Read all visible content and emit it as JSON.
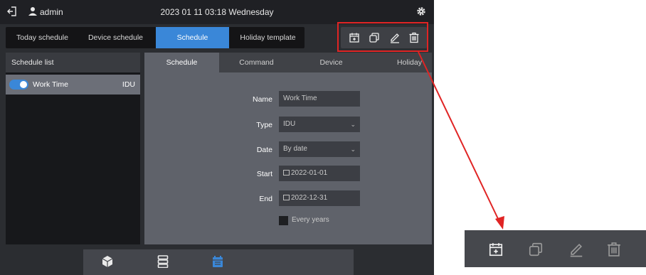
{
  "header": {
    "user": "admin",
    "datetime": "2023 01 11 03:18 Wednesday"
  },
  "nav": {
    "tabs": [
      "Today schedule",
      "Device schedule",
      "Schedule",
      "Holiday template"
    ],
    "active": "Schedule"
  },
  "toolbar": {
    "icons": [
      "add-schedule-icon",
      "copy-icon",
      "edit-icon",
      "delete-icon"
    ]
  },
  "schedule_list": {
    "title": "Schedule list",
    "items": [
      {
        "name": "Work Time",
        "type": "IDU",
        "enabled": true
      }
    ]
  },
  "detail_tabs": [
    "Schedule",
    "Command",
    "Device",
    "Holiday"
  ],
  "form": {
    "name_label": "Name",
    "name_value": "Work Time",
    "type_label": "Type",
    "type_value": "IDU",
    "date_label": "Date",
    "date_value": "By date",
    "start_label": "Start",
    "start_value": "2022-01-01",
    "end_label": "End",
    "end_value": "2022-12-31",
    "every_years_label": "Every years",
    "every_years_checked": false
  },
  "bottom_nav": {
    "icons": [
      "device-box-icon",
      "server-list-icon",
      "calendar-icon"
    ],
    "active": "calendar-icon"
  },
  "colors": {
    "accent": "#3a87d8",
    "highlight": "#e02424"
  }
}
